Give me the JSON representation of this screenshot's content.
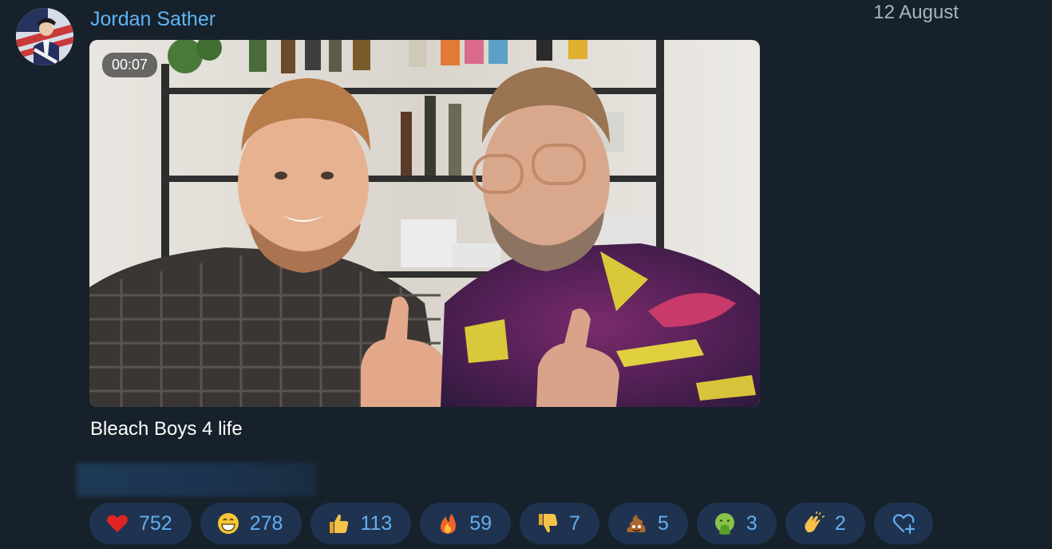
{
  "message": {
    "sender": "Jordan Sather",
    "date": "12 August",
    "video": {
      "duration": "00:07"
    },
    "caption": "Bleach Boys 4 life"
  },
  "reactions": [
    {
      "icon": "heart-icon",
      "count": "752"
    },
    {
      "icon": "grinning-face-icon",
      "count": "278"
    },
    {
      "icon": "thumbs-up-icon",
      "count": "113"
    },
    {
      "icon": "fire-icon",
      "count": "59"
    },
    {
      "icon": "thumbs-down-icon",
      "count": "7"
    },
    {
      "icon": "poop-icon",
      "count": "5"
    },
    {
      "icon": "vomiting-face-icon",
      "count": "3"
    },
    {
      "icon": "clapping-hands-icon",
      "count": "2"
    }
  ],
  "add_reaction_icon": "heart-plus-icon"
}
